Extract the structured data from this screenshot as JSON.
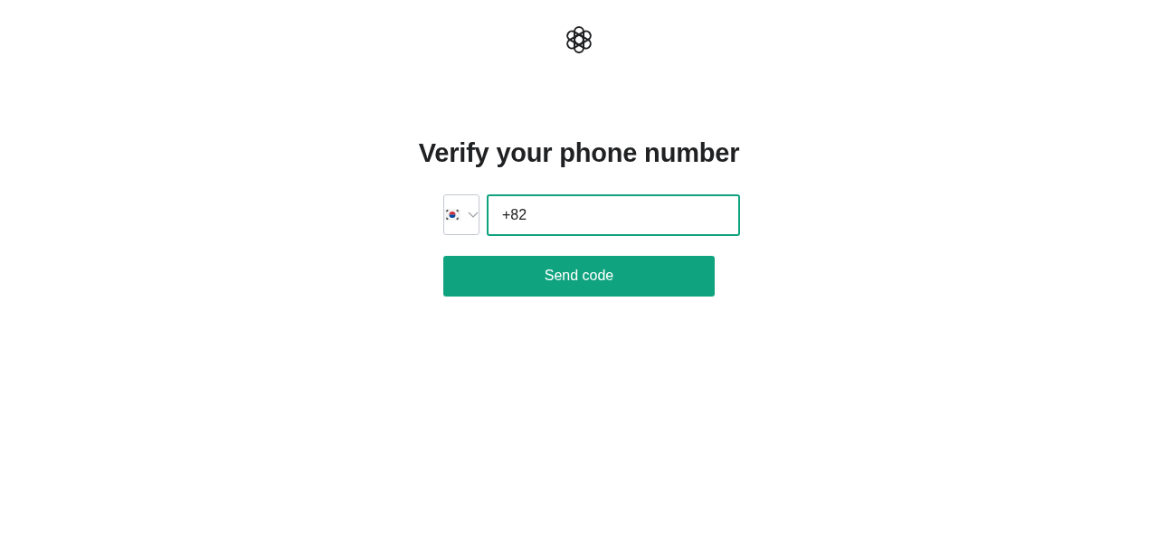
{
  "title": "Verify your phone number",
  "phone": {
    "country_prefix": "+82",
    "focused": true
  },
  "button": {
    "label": "Send code"
  }
}
